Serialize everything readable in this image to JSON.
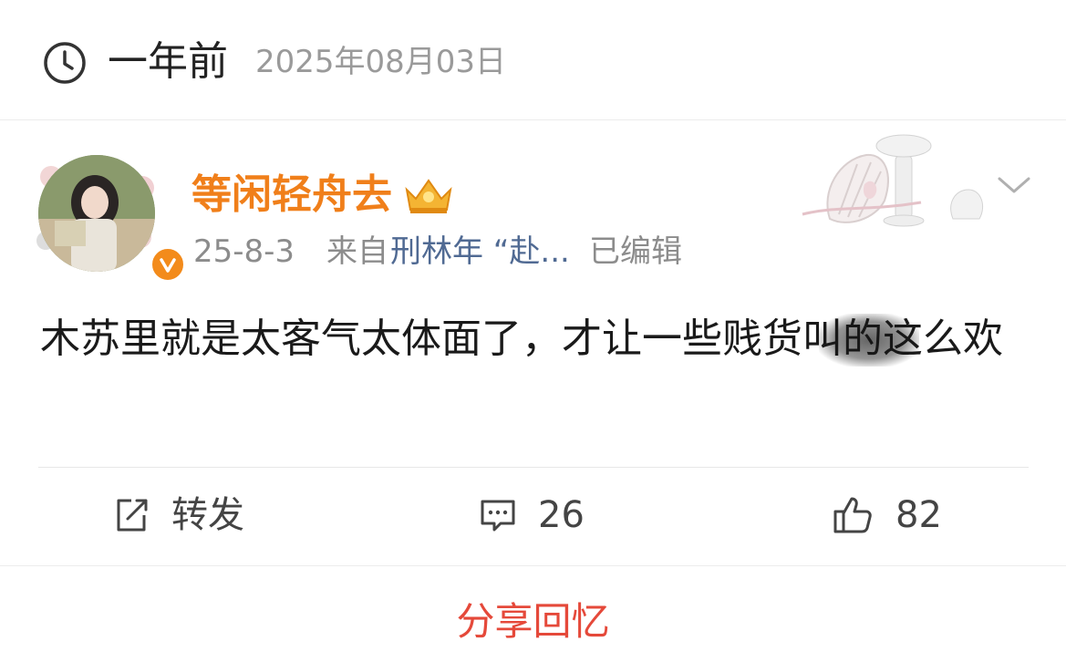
{
  "memory": {
    "ago_label": "一年前",
    "date_label": "2025年08月03日"
  },
  "post": {
    "username": "等闲轻舟去",
    "time": "25-8-3",
    "from_label": "来自",
    "source": "刑林年 “赴...",
    "edited_label": "已编辑",
    "text": "木苏里就是太客气太体面了，才让一些贱货叫的这么欢"
  },
  "actions": {
    "repost_label": "转发",
    "comment_count": "26",
    "like_count": "82"
  },
  "share_label": "分享回忆",
  "colors": {
    "username": "#f07f1a",
    "source_link": "#506a93",
    "share": "#e5493a",
    "verified_badge": "#f38b1b"
  },
  "icons": [
    "clock-icon",
    "crown-icon",
    "verified-icon",
    "chevron-down-icon",
    "repost-icon",
    "comment-icon",
    "like-icon"
  ]
}
